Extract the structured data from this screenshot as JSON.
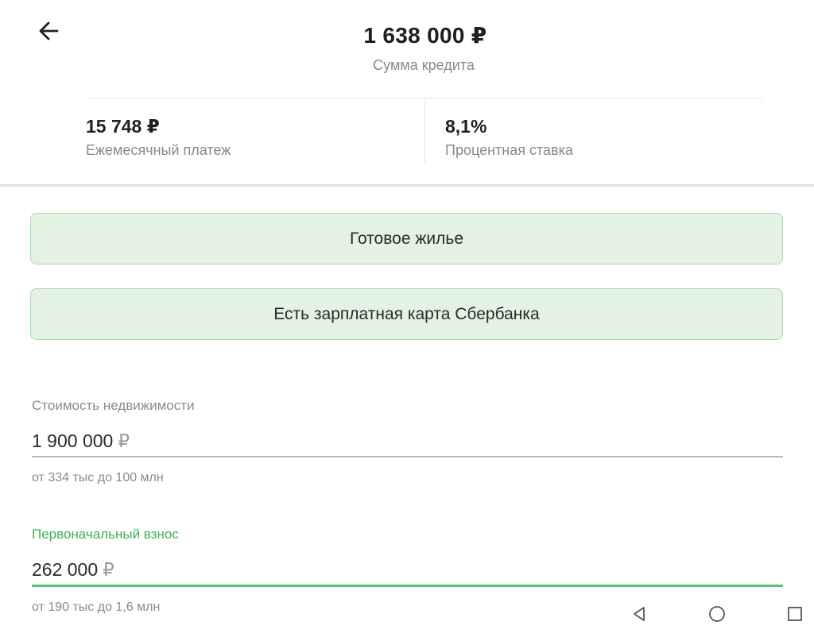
{
  "header": {
    "back_icon": "arrow-left-icon",
    "loan_amount": "1 638 000 ₽",
    "loan_amount_label": "Сумма кредита",
    "monthly_payment": {
      "value": "15 748 ₽",
      "label": "Ежемесячный платеж"
    },
    "interest_rate": {
      "value": "8,1%",
      "label": "Процентная ставка"
    }
  },
  "options": [
    {
      "label": "Готовое жилье"
    },
    {
      "label": "Есть зарплатная карта Сбербанка"
    }
  ],
  "fields": {
    "property_price": {
      "label": "Стоимость недвижимости",
      "value": "1 900 000",
      "currency": "₽",
      "hint": "от 334 тыс до 100 млн"
    },
    "down_payment": {
      "label": "Первоначальный взнос",
      "value": "262 000",
      "currency": "₽",
      "hint": "от 190 тыс до 1,6 млн"
    }
  },
  "nav_bar": {
    "icons": [
      "triangle-back-icon",
      "circle-home-icon",
      "square-recent-icon"
    ]
  },
  "colors": {
    "accent": "#3fb35a",
    "option_background": "#e3f2e3",
    "option_border": "#a9dba9",
    "muted_text": "#8a8a8a"
  }
}
